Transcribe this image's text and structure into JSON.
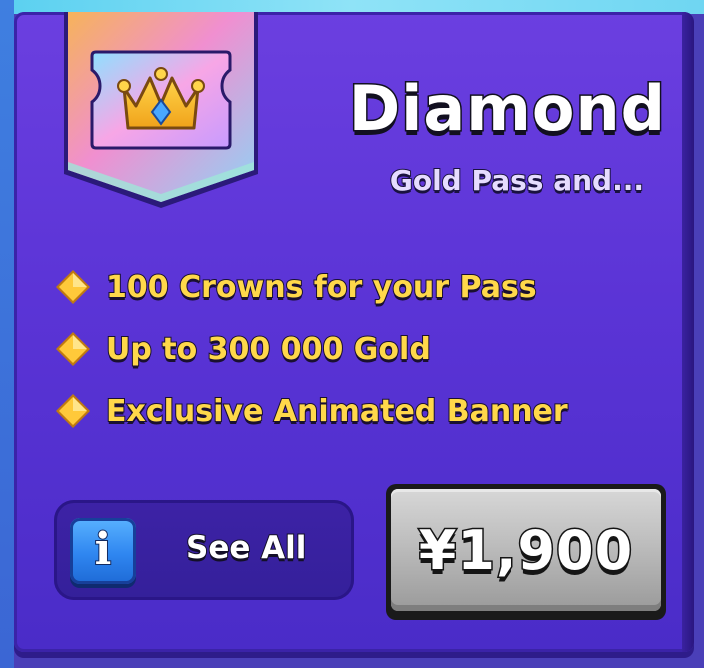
{
  "pass": {
    "title": "Diamond",
    "subtitle": "Gold Pass and...",
    "badge_icon": "crown-with-gem-icon",
    "features": [
      {
        "icon": "gold-diamond-icon",
        "label": "100 Crowns for your Pass"
      },
      {
        "icon": "gold-diamond-icon",
        "label": "Up to 300 000 Gold"
      },
      {
        "icon": "gold-diamond-icon",
        "label": "Exclusive Animated Banner"
      }
    ],
    "see_all": {
      "icon": "info-icon",
      "info_glyph": "i",
      "label": "See All"
    },
    "price": "¥1,900"
  },
  "colors": {
    "card_purple": "#5b34d6",
    "feature_text": "#ffd84a",
    "info_blue": "#2f86f0",
    "price_button_gray": "#bdbdbd"
  }
}
